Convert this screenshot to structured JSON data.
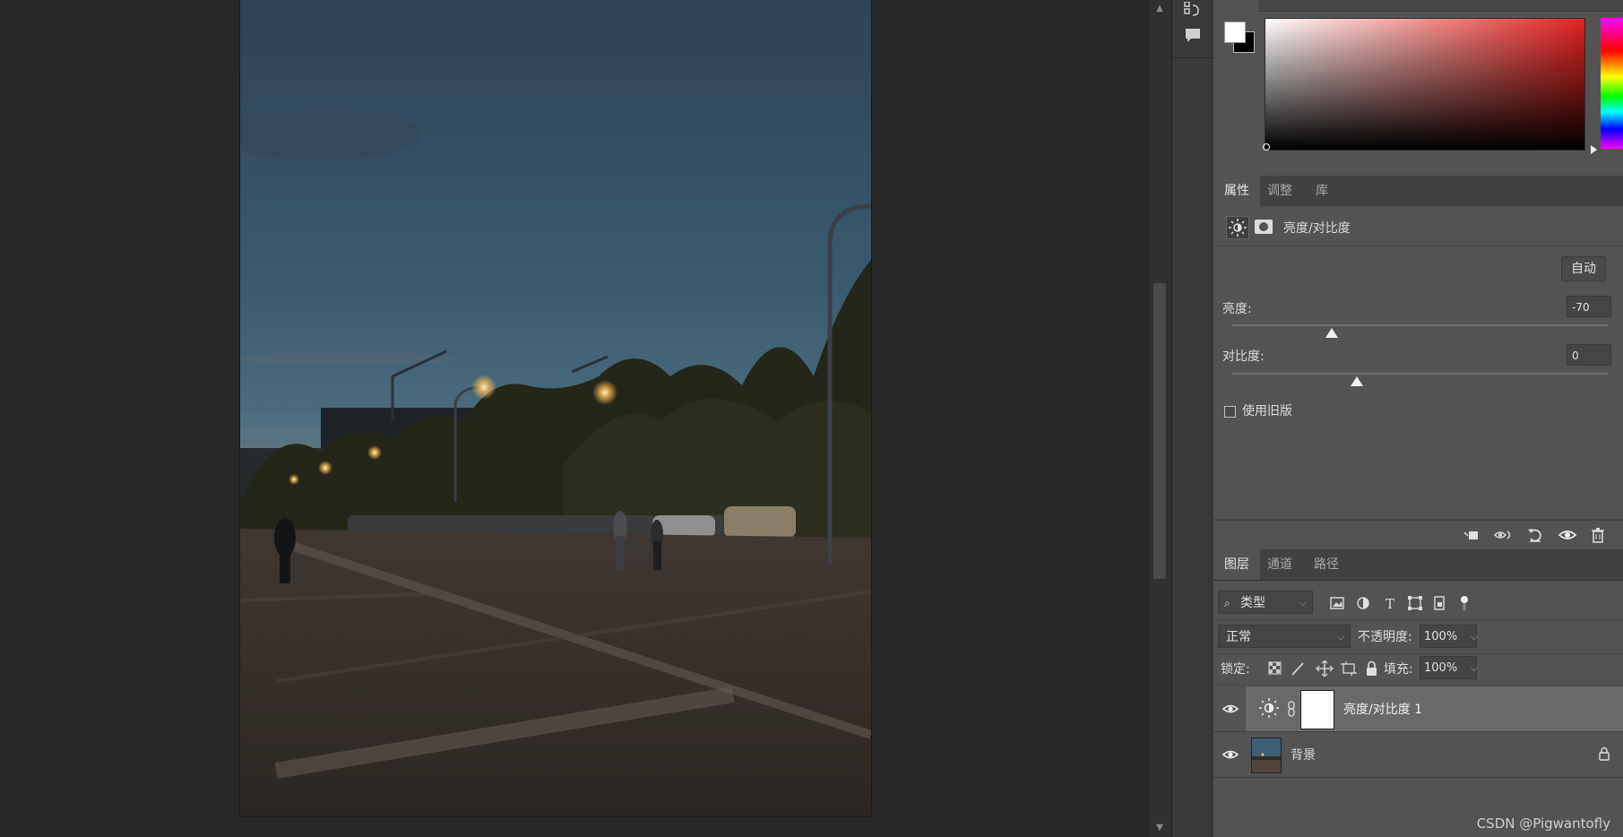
{
  "properties_panel": {
    "tabs": [
      {
        "label": "属性",
        "active": true
      },
      {
        "label": "调整",
        "active": false
      },
      {
        "label": "库",
        "active": false
      }
    ],
    "adjustment_title": "亮度/对比度",
    "auto_button": "自动",
    "brightness_label": "亮度:",
    "brightness_value": "-70",
    "brightness_level": -70,
    "contrast_label": "对比度:",
    "contrast_value": "0",
    "contrast_level": 0,
    "legacy_checkbox_label": "使用旧版",
    "legacy_checked": false
  },
  "layers_panel": {
    "tabs": [
      {
        "label": "图层",
        "active": true
      },
      {
        "label": "通道",
        "active": false
      },
      {
        "label": "路径",
        "active": false
      }
    ],
    "filter_kind": "类型",
    "blend_mode": "正常",
    "opacity_label": "不透明度:",
    "opacity_value": "100%",
    "lock_label": "锁定:",
    "fill_label": "填充:",
    "fill_value": "100%",
    "layers": [
      {
        "name": "亮度/对比度 1",
        "selected": true,
        "visible": true
      },
      {
        "name": "背景",
        "selected": false,
        "visible": true,
        "locked": true
      }
    ]
  },
  "colors": {
    "foreground": "#ffffff",
    "background": "#000000",
    "panel_bg": "#535353",
    "workspace_bg": "#282828"
  },
  "watermark": "CSDN @Pigwantofly"
}
